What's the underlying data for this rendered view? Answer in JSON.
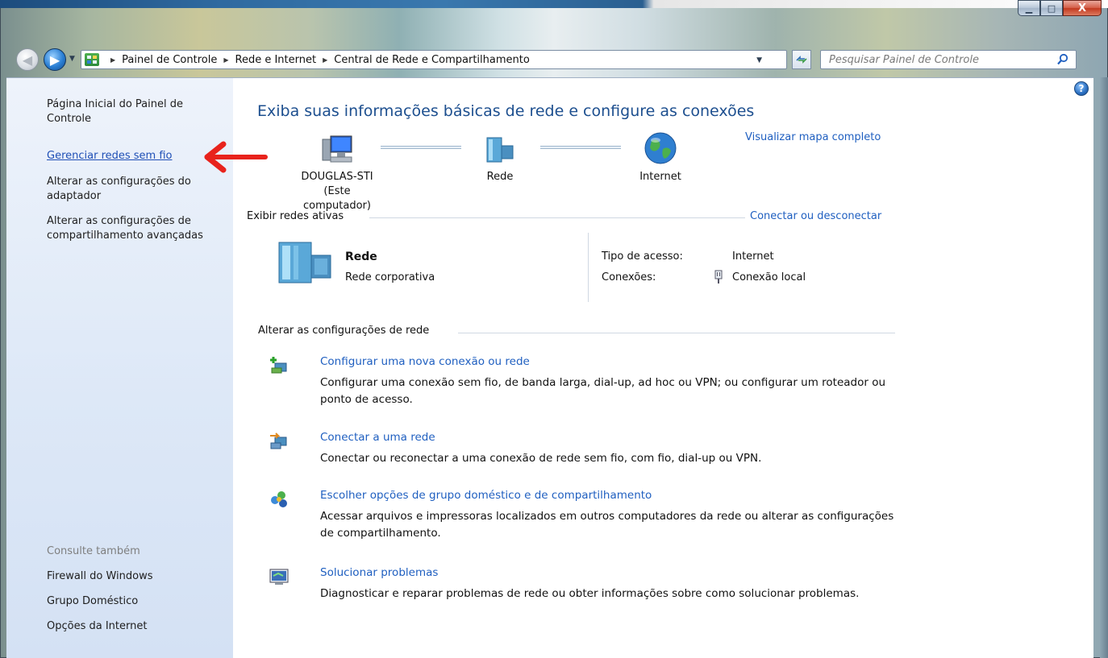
{
  "window": {
    "min_label": "▁",
    "max_label": "□",
    "close_label": "X"
  },
  "address": {
    "breadcrumbs": [
      "Painel de Controle",
      "Rede e Internet",
      "Central de Rede e Compartilhamento"
    ],
    "search_placeholder": "Pesquisar Painel de Controle"
  },
  "sidebar": {
    "home": "Página Inicial do Painel de Controle",
    "links": [
      "Gerenciar redes sem fio",
      "Alterar as configurações do adaptador",
      "Alterar as configurações de compartilhamento avançadas"
    ],
    "see_also_title": "Consulte também",
    "see_also": [
      "Firewall do Windows",
      "Grupo Doméstico",
      "Opções da Internet"
    ]
  },
  "main": {
    "title": "Exiba suas informações básicas de rede e configure as conexões",
    "view_full_map": "Visualizar mapa completo",
    "map": {
      "computer_name": "DOUGLAS-STI",
      "computer_sub": "(Este computador)",
      "network": "Rede",
      "internet": "Internet"
    },
    "active_networks_title": "Exibir redes ativas",
    "connect_disconnect": "Conectar ou desconectar",
    "active": {
      "name": "Rede",
      "type": "Rede corporativa",
      "access_label": "Tipo de acesso:",
      "access_value": "Internet",
      "connections_label": "Conexões:",
      "connections_value": "Conexão local"
    },
    "change_settings_title": "Alterar as configurações de rede",
    "tasks": [
      {
        "title": "Configurar uma nova conexão ou rede",
        "desc": "Configurar uma conexão sem fio, de banda larga, dial-up, ad hoc ou VPN; ou configurar um roteador ou ponto de acesso."
      },
      {
        "title": "Conectar a uma rede",
        "desc": "Conectar ou reconectar a uma conexão de rede sem fio, com fio, dial-up ou VPN."
      },
      {
        "title": "Escolher opções de grupo doméstico e de compartilhamento",
        "desc": "Acessar arquivos e impressoras localizados em outros computadores da rede ou alterar as configurações de compartilhamento."
      },
      {
        "title": "Solucionar problemas",
        "desc": "Diagnosticar e reparar problemas de rede ou obter informações sobre como solucionar problemas."
      }
    ]
  },
  "colors": {
    "link": "#1f5fc0",
    "title": "#1d4f8f",
    "annotation_arrow": "#e8231c",
    "sidebar_bg": "#dde8f7"
  }
}
